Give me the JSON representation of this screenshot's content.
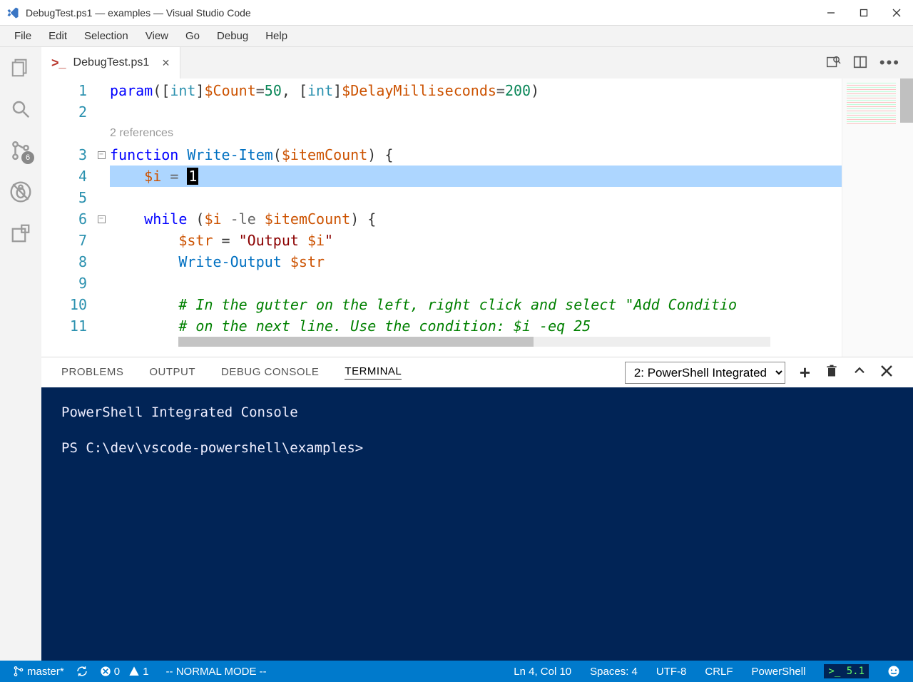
{
  "title": "DebugTest.ps1 — examples — Visual Studio Code",
  "menu": [
    "File",
    "Edit",
    "Selection",
    "View",
    "Go",
    "Debug",
    "Help"
  ],
  "activity_badge": "6",
  "tab": {
    "name": "DebugTest.ps1"
  },
  "codelens": "2 references",
  "lines": [
    "1",
    "2",
    "3",
    "4",
    "5",
    "6",
    "7",
    "8",
    "9",
    "10",
    "11"
  ],
  "code": {
    "l1": {
      "param": "param",
      "lb": "([",
      "int1": "int",
      "rb1": "]",
      "v1": "$Count",
      "eq1": "=",
      "n1": "50",
      "c": ", [",
      "int2": "int",
      "rb2": "]",
      "v2": "$DelayMilliseconds",
      "eq2": "=",
      "n2": "200",
      "end": ")"
    },
    "l3": {
      "fn": "function",
      "name": "Write-Item",
      "lp": "(",
      "p": "$itemCount",
      "rp": ") {"
    },
    "l4": {
      "indent": "    ",
      "v": "$i",
      "sp": " ",
      "eq": "=",
      "sp2": " ",
      "cur": "1"
    },
    "l6": {
      "indent": "    ",
      "while": "while",
      "lp": " (",
      "v": "$i",
      "op": " -le ",
      "v2": "$itemCount",
      "rp": ") {"
    },
    "l7": {
      "indent": "        ",
      "v": "$str",
      "eq": " = ",
      "s1": "\"Output ",
      "v2": "$i",
      "s2": "\""
    },
    "l8": {
      "indent": "        ",
      "cmd": "Write-Output",
      "sp": " ",
      "v": "$str"
    },
    "l10": {
      "indent": "        ",
      "c": "# In the gutter on the left, right click and select \"Add Conditio"
    },
    "l11": {
      "indent": "        ",
      "c": "# on the next line. Use the condition: $i -eq 25"
    }
  },
  "panel": {
    "tabs": [
      "PROBLEMS",
      "OUTPUT",
      "DEBUG CONSOLE",
      "TERMINAL"
    ],
    "active": 3,
    "select": "2: PowerShell Integrated",
    "term_line1": "PowerShell Integrated Console",
    "term_line2": "PS C:\\dev\\vscode-powershell\\examples>"
  },
  "status": {
    "branch": "master*",
    "errors": "0",
    "warnings": "1",
    "mode": "-- NORMAL MODE --",
    "pos": "Ln 4, Col 10",
    "spaces": "Spaces: 4",
    "encoding": "UTF-8",
    "eol": "CRLF",
    "lang": "PowerShell",
    "psver": ">_ 5.1"
  }
}
